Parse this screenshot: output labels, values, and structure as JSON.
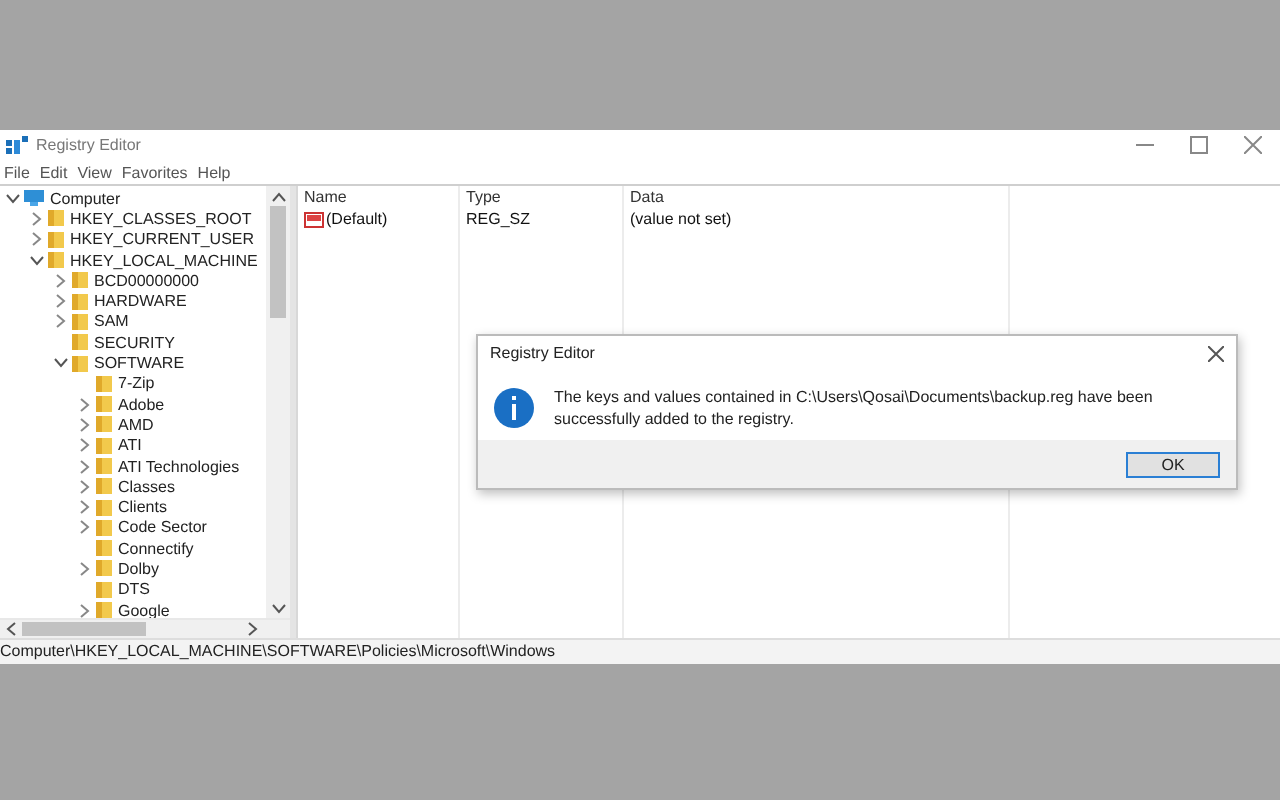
{
  "window": {
    "title": "Registry Editor"
  },
  "menu": [
    "File",
    "Edit",
    "View",
    "Favorites",
    "Help"
  ],
  "tree": [
    {
      "label": "Computer",
      "kind": "computer",
      "expanded": true,
      "children": [
        {
          "label": "HKEY_CLASSES_ROOT",
          "kind": "folder",
          "expanded": false
        },
        {
          "label": "HKEY_CURRENT_USER",
          "kind": "folder",
          "expanded": false
        },
        {
          "label": "HKEY_LOCAL_MACHINE",
          "kind": "folder",
          "expanded": true,
          "children": [
            {
              "label": "BCD00000000",
              "kind": "folder",
              "expanded": false
            },
            {
              "label": "HARDWARE",
              "kind": "folder",
              "expanded": false
            },
            {
              "label": "SAM",
              "kind": "folder",
              "expanded": false
            },
            {
              "label": "SECURITY",
              "kind": "folder"
            },
            {
              "label": "SOFTWARE",
              "kind": "folder",
              "expanded": true,
              "children": [
                {
                  "label": "7-Zip",
                  "kind": "folder"
                },
                {
                  "label": "Adobe",
                  "kind": "folder",
                  "expanded": false
                },
                {
                  "label": "AMD",
                  "kind": "folder",
                  "expanded": false
                },
                {
                  "label": "ATI",
                  "kind": "folder",
                  "expanded": false
                },
                {
                  "label": "ATI Technologies",
                  "kind": "folder",
                  "expanded": false
                },
                {
                  "label": "Classes",
                  "kind": "folder",
                  "expanded": false
                },
                {
                  "label": "Clients",
                  "kind": "folder",
                  "expanded": false
                },
                {
                  "label": "Code Sector",
                  "kind": "folder",
                  "expanded": false
                },
                {
                  "label": "Connectify",
                  "kind": "folder"
                },
                {
                  "label": "Dolby",
                  "kind": "folder",
                  "expanded": false
                },
                {
                  "label": "DTS",
                  "kind": "folder"
                },
                {
                  "label": "Google",
                  "kind": "folder",
                  "expanded": false
                }
              ]
            }
          ]
        }
      ]
    }
  ],
  "list": {
    "columns": [
      "Name",
      "Type",
      "Data"
    ],
    "rows": [
      {
        "name": "(Default)",
        "type": "REG_SZ",
        "data": "(value not set)"
      }
    ]
  },
  "dialog": {
    "title": "Registry Editor",
    "message": "The keys and values contained in C:\\Users\\Qosai\\Documents\\backup.reg have been successfully added to the registry.",
    "button": "OK"
  },
  "status_bar": "Computer\\HKEY_LOCAL_MACHINE\\SOFTWARE\\Policies\\Microsoft\\Windows"
}
